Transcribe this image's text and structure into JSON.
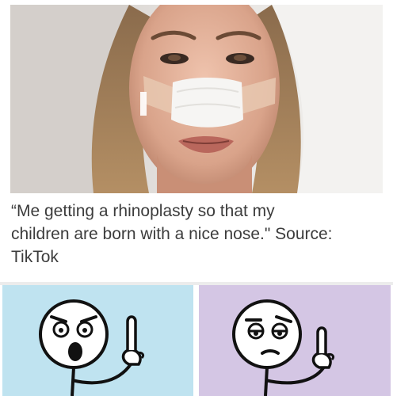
{
  "caption": {
    "line1": "“Me getting a rhinoplasty so that my",
    "line2": "children are born with a nice nose.\" Source:",
    "line3": "TikTok"
  },
  "colors": {
    "panel_left_bg": "#bfe3f0",
    "panel_right_bg": "#d4c6e4",
    "caption_text": "#3c3c3c"
  },
  "icons": [
    "thinking-finger-up-meme-left",
    "thinking-finger-up-meme-right"
  ]
}
